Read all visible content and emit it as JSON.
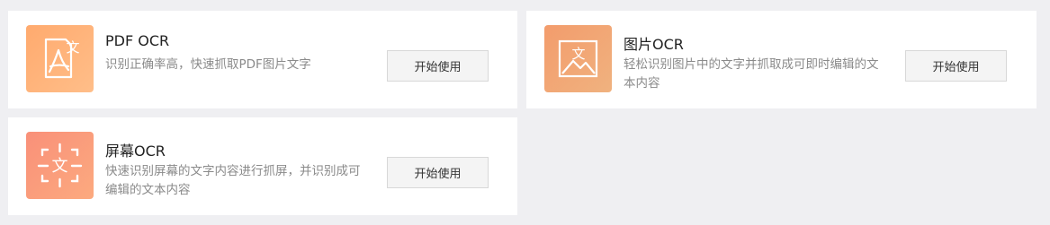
{
  "cards": [
    {
      "title": "PDF OCR",
      "description": "识别正确率高，快速抓取PDF图片文字",
      "button_label": "开始使用",
      "icon": "pdf-document-icon",
      "tile_color": "#ffb07a"
    },
    {
      "title": "图片OCR",
      "description": "轻松识别图片中的文字并抓取成可即时编辑的文本内容",
      "button_label": "开始使用",
      "icon": "picture-icon",
      "tile_color": "#f2a676"
    },
    {
      "title": "屏幕OCR",
      "description": "快速识别屏幕的文字内容进行抓屏，并识别成可编辑的文本内容",
      "button_label": "开始使用",
      "icon": "screen-capture-icon",
      "tile_color": "#fa9d7b"
    }
  ],
  "icon_glyph": "文",
  "colors": {
    "background": "#efeff2",
    "card": "#ffffff",
    "button_bg": "#f4f4f4",
    "button_border": "#d8d8d8"
  }
}
